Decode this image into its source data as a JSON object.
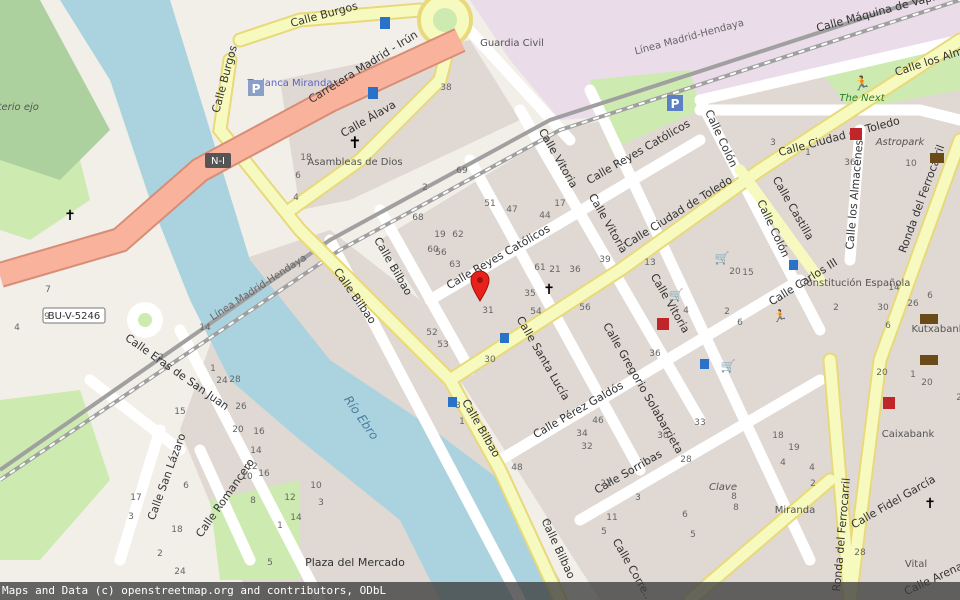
{
  "map": {
    "streets": [
      {
        "id": "calle-burgos-top",
        "label": "Calle Burgos"
      },
      {
        "id": "calle-burgos-left",
        "label": "Calle Burgos"
      },
      {
        "id": "carretera",
        "label": "Carretera Madrid - Irún"
      },
      {
        "id": "calle-alava",
        "label": "Calle Álava"
      },
      {
        "id": "calle-vitoria-1",
        "label": "Calle Vitoria"
      },
      {
        "id": "calle-vitoria-2",
        "label": "Calle Vitoria"
      },
      {
        "id": "calle-vitoria-3",
        "label": "Calle Vitoria"
      },
      {
        "id": "calle-reyes-1",
        "label": "Calle Reyes Católicos"
      },
      {
        "id": "calle-reyes-2",
        "label": "Calle Reyes Católicos"
      },
      {
        "id": "calle-colon-1",
        "label": "Calle Colón"
      },
      {
        "id": "calle-colon-2",
        "label": "Calle Colón"
      },
      {
        "id": "calle-ciudad-toledo-1",
        "label": "Calle Ciudad de Toledo"
      },
      {
        "id": "calle-ciudad-toledo-2",
        "label": "Calle Ciudad de Toledo"
      },
      {
        "id": "calle-maquina",
        "label": "Calle Máquina de Vap..."
      },
      {
        "id": "calle-los-alm",
        "label": "Calle los Alm"
      },
      {
        "id": "calle-los-almacenes",
        "label": "Calle los Almacenes"
      },
      {
        "id": "calle-castilla",
        "label": "Calle Castilla"
      },
      {
        "id": "ronda-ferrocarril-1",
        "label": "Ronda del Ferrocarril"
      },
      {
        "id": "ronda-ferrocarril-2",
        "label": "Ronda del Ferrocarril"
      },
      {
        "id": "calle-bilbao-1",
        "label": "Calle Bilbao"
      },
      {
        "id": "calle-bilbao-2",
        "label": "Calle Bilbao"
      },
      {
        "id": "calle-bilbao-3",
        "label": "Calle Bilbao"
      },
      {
        "id": "calle-bilbao-4",
        "label": "Calle Bilbao"
      },
      {
        "id": "calle-santa-lucia",
        "label": "Calle Santa Lucía"
      },
      {
        "id": "calle-gregorio",
        "label": "Calle Gregorio Solabarrieta"
      },
      {
        "id": "calle-carlos",
        "label": "Calle Carlos III"
      },
      {
        "id": "calle-perez",
        "label": "Calle Pérez Galdós"
      },
      {
        "id": "calle-sorribas",
        "label": "Calle Sorribas"
      },
      {
        "id": "calle-fidel",
        "label": "Calle Fidel García"
      },
      {
        "id": "calle-correo",
        "label": "Calle Corre..."
      },
      {
        "id": "calle-arena",
        "label": "Calle Arena"
      },
      {
        "id": "calle-eras",
        "label": "Calle Eras de San Juan"
      },
      {
        "id": "calle-san-lazaro",
        "label": "Calle San Lázaro"
      },
      {
        "id": "calle-romancero",
        "label": "Calle Romancero"
      },
      {
        "id": "linea-1",
        "label": "Línea Madrid-Hendaya"
      },
      {
        "id": "linea-2",
        "label": "Línea Madrid-Hendaya"
      }
    ],
    "road_refs": [
      "N-I",
      "BU-V-5246"
    ],
    "water": [
      "Río Ebro"
    ],
    "places": [
      {
        "id": "guardia-civil",
        "label": "Guardia Civil"
      },
      {
        "id": "tudanca",
        "label": "Tudanca Miranda"
      },
      {
        "id": "asambleas",
        "label": "Asambleas de Dios"
      },
      {
        "id": "the-next",
        "label": "The Next"
      },
      {
        "id": "astropark",
        "label": "Astropark"
      },
      {
        "id": "constitucion",
        "label": "Constitución Española"
      },
      {
        "id": "kutxabank",
        "label": "Kutxabank"
      },
      {
        "id": "caixabank",
        "label": "Caixabank"
      },
      {
        "id": "clave",
        "label": "Clave"
      },
      {
        "id": "miranda",
        "label": "Miranda"
      },
      {
        "id": "vital",
        "label": "Vital"
      },
      {
        "id": "plaza-mercado",
        "label": "Plaza del Mercado"
      },
      {
        "id": "cementerio",
        "label": "enterio ejo"
      }
    ],
    "house_numbers": [
      "38",
      "18",
      "6",
      "4",
      "2",
      "68",
      "69",
      "51",
      "47",
      "44",
      "17",
      "19",
      "62",
      "60",
      "56",
      "63",
      "61",
      "21",
      "39",
      "36",
      "35",
      "31",
      "52",
      "53",
      "56",
      "54",
      "30",
      "13",
      "4",
      "36",
      "20",
      "15",
      "6",
      "2",
      "3",
      "1",
      "48",
      "46",
      "34",
      "32",
      "33",
      "28",
      "30",
      "22",
      "11",
      "5",
      "3",
      "1",
      "14",
      "1",
      "24",
      "28",
      "26",
      "20",
      "16",
      "14",
      "12",
      "10",
      "8",
      "6",
      "2",
      "15",
      "17",
      "3",
      "2",
      "24",
      "18",
      "16",
      "12",
      "1",
      "14",
      "10",
      "3",
      "5",
      "7",
      "9",
      "4",
      "30",
      "6",
      "2",
      "1",
      "20",
      "22",
      "20",
      "18",
      "19",
      "4",
      "4",
      "2",
      "8",
      "8",
      "6",
      "5",
      "3",
      "1",
      "36",
      "10",
      "14",
      "6",
      "26",
      "28",
      "34",
      "1",
      "6"
    ],
    "marker_label": "selected-location",
    "colors": {
      "water": "#aad3df",
      "land": "#f2efe9",
      "building": "#d9d0c9",
      "trunk": "#f9b29c",
      "secondary": "#f7fabf",
      "park": "#cdebb0",
      "rail": "#9a9a9a",
      "marker": "#e8211b"
    }
  },
  "attribution": "Maps and Data (c) openstreetmap.org and contributors, ODbL"
}
